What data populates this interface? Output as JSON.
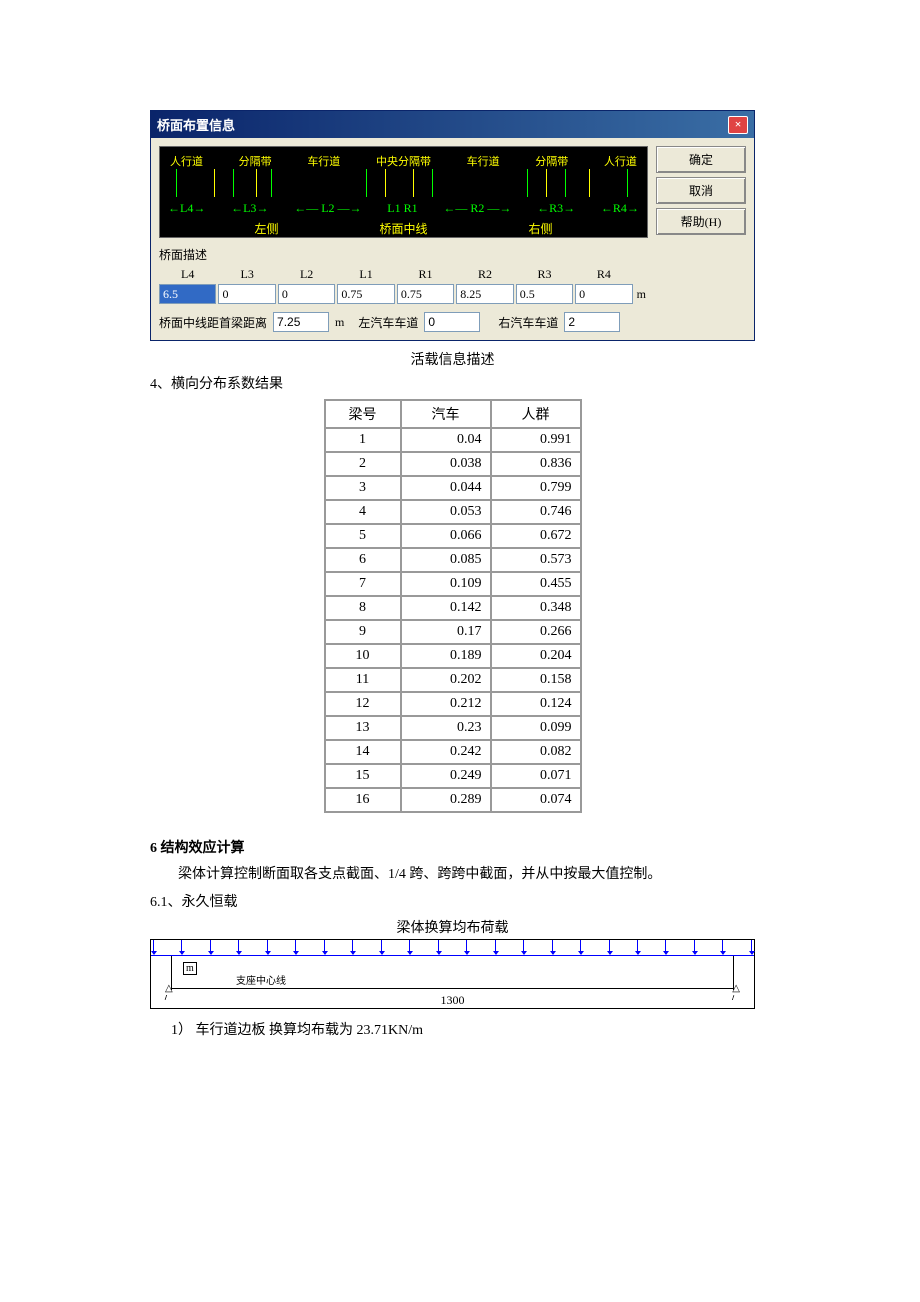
{
  "dialog": {
    "title": "桥面布置信息",
    "buttons": {
      "ok": "确定",
      "cancel": "取消",
      "help": "帮助(H)"
    },
    "diagram_top": [
      "人行道",
      "分隔带",
      "车行道",
      "中央分隔带",
      "车行道",
      "分隔带",
      "人行道"
    ],
    "diagram_mid": [
      "L4",
      "L3",
      "L2",
      "L1",
      "R1",
      "R2",
      "R3",
      "R4"
    ],
    "diagram_bot": [
      "左侧",
      "桥面中线",
      "右侧"
    ],
    "desc_label": "桥面描述",
    "fields": {
      "L4": {
        "label": "L4",
        "value": "6.5"
      },
      "L3": {
        "label": "L3",
        "value": "0"
      },
      "L2": {
        "label": "L2",
        "value": "0"
      },
      "L1": {
        "label": "L1",
        "value": "0.75"
      },
      "R1": {
        "label": "R1",
        "value": "0.75"
      },
      "R2": {
        "label": "R2",
        "value": "8.25"
      },
      "R3": {
        "label": "R3",
        "value": "0.5"
      },
      "R4": {
        "label": "R4",
        "value": "0"
      }
    },
    "unit": "m",
    "row2": {
      "l1": "桥面中线距首梁距离",
      "v1": "7.25",
      "u1": "m",
      "l2": "左汽车车道",
      "v2": "0",
      "l3": "右汽车车道",
      "v3": "2"
    }
  },
  "caption": "活载信息描述",
  "section4": "4、横向分布系数结果",
  "table": {
    "headers": [
      "梁号",
      "汽车",
      "人群"
    ],
    "rows": [
      [
        "1",
        "0.04",
        "0.991"
      ],
      [
        "2",
        "0.038",
        "0.836"
      ],
      [
        "3",
        "0.044",
        "0.799"
      ],
      [
        "4",
        "0.053",
        "0.746"
      ],
      [
        "5",
        "0.066",
        "0.672"
      ],
      [
        "6",
        "0.085",
        "0.573"
      ],
      [
        "7",
        "0.109",
        "0.455"
      ],
      [
        "8",
        "0.142",
        "0.348"
      ],
      [
        "9",
        "0.17",
        "0.266"
      ],
      [
        "10",
        "0.189",
        "0.204"
      ],
      [
        "11",
        "0.202",
        "0.158"
      ],
      [
        "12",
        "0.212",
        "0.124"
      ],
      [
        "13",
        "0.23",
        "0.099"
      ],
      [
        "14",
        "0.242",
        "0.082"
      ],
      [
        "15",
        "0.249",
        "0.071"
      ],
      [
        "16",
        "0.289",
        "0.074"
      ]
    ]
  },
  "h6": "6 结构效应计算",
  "para": "梁体计算控制断面取各支点截面、1/4 跨、跨跨中截面，并从中按最大值控制。",
  "s61": "6.1、永久恒载",
  "beam_title": "梁体换算均布荷载",
  "beam_label": "支座中心线",
  "beam_m": "m",
  "beam_span": "1300",
  "note1": "1） 车行道边板 换算均布载为 23.71KN/m"
}
